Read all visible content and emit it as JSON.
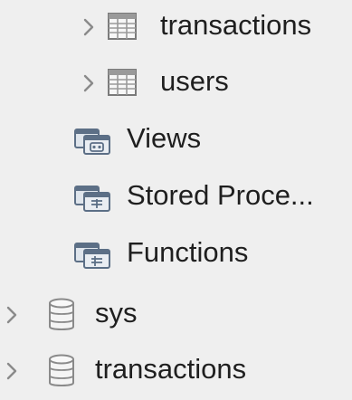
{
  "tree": {
    "items": [
      {
        "label": "transactions",
        "icon": "table-icon",
        "expandable": true
      },
      {
        "label": "users",
        "icon": "table-icon",
        "expandable": true
      },
      {
        "label": "Views",
        "icon": "views-folder-icon",
        "expandable": false
      },
      {
        "label": "Stored Proce...",
        "icon": "stored-procedures-folder-icon",
        "expandable": false
      },
      {
        "label": "Functions",
        "icon": "functions-folder-icon",
        "expandable": false
      },
      {
        "label": "sys",
        "icon": "database-icon",
        "expandable": true
      },
      {
        "label": "transactions",
        "icon": "database-icon",
        "expandable": true
      }
    ]
  },
  "colors": {
    "background": "#efefef",
    "text": "#1f1f1f",
    "chevron": "#8a8a8a",
    "icon_stroke": "#7a7a7a",
    "folder_icon": "#5c6f86"
  }
}
